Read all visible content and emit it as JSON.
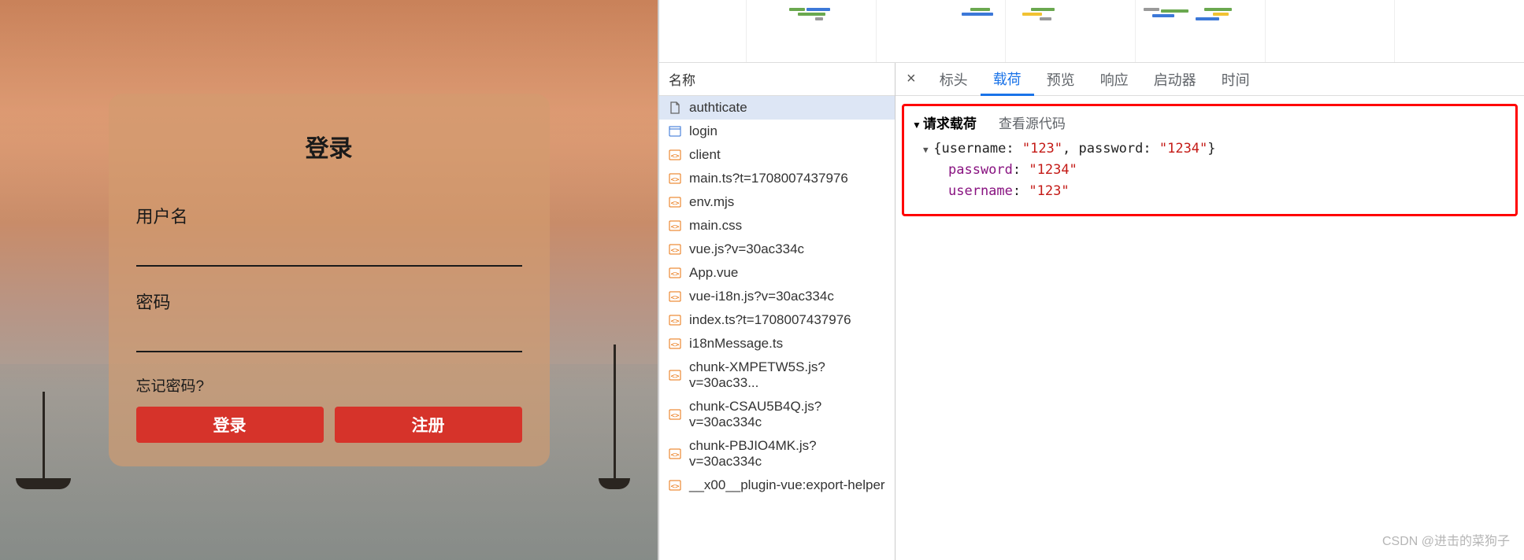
{
  "login": {
    "title": "登录",
    "username_label": "用户名",
    "password_label": "密码",
    "forgot_text": "忘记密码?",
    "login_btn": "登录",
    "register_btn": "注册"
  },
  "network": {
    "header": "名称",
    "items": [
      {
        "icon": "doc",
        "name": "authticate",
        "selected": true
      },
      {
        "icon": "html",
        "name": "login"
      },
      {
        "icon": "js",
        "name": "client"
      },
      {
        "icon": "js",
        "name": "main.ts?t=1708007437976"
      },
      {
        "icon": "js",
        "name": "env.mjs"
      },
      {
        "icon": "js",
        "name": "main.css"
      },
      {
        "icon": "js",
        "name": "vue.js?v=30ac334c"
      },
      {
        "icon": "js",
        "name": "App.vue"
      },
      {
        "icon": "js",
        "name": "vue-i18n.js?v=30ac334c"
      },
      {
        "icon": "js",
        "name": "index.ts?t=1708007437976"
      },
      {
        "icon": "js",
        "name": "i18nMessage.ts"
      },
      {
        "icon": "js",
        "name": "chunk-XMPETW5S.js?v=30ac33..."
      },
      {
        "icon": "js",
        "name": "chunk-CSAU5B4Q.js?v=30ac334c"
      },
      {
        "icon": "js",
        "name": "chunk-PBJIO4MK.js?v=30ac334c"
      },
      {
        "icon": "js",
        "name": "__x00__plugin-vue:export-helper"
      }
    ]
  },
  "tabs": {
    "headers": "标头",
    "payload": "载荷",
    "preview": "预览",
    "response": "响应",
    "initiator": "启动器",
    "timing": "时间"
  },
  "payload": {
    "title": "请求载荷",
    "view_source": "查看源代码",
    "summary_prefix": "{username: ",
    "summary_user_val": "\"123\"",
    "summary_mid": ", password: ",
    "summary_pass_val": "\"1234\"",
    "summary_suffix": "}",
    "rows": [
      {
        "key": "password",
        "value": "\"1234\""
      },
      {
        "key": "username",
        "value": "\"123\""
      }
    ]
  },
  "watermark": "CSDN @进击的菜狗子"
}
